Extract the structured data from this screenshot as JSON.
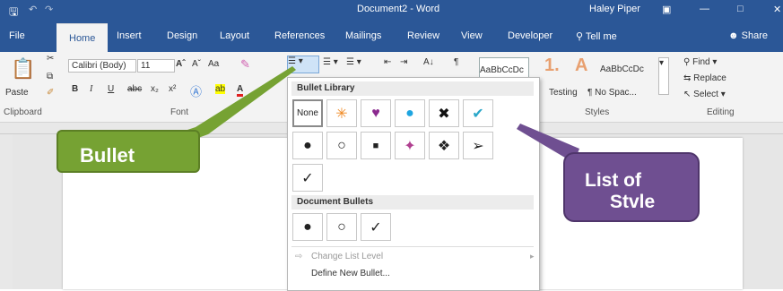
{
  "title_bar": {
    "save_icon": "save-icon",
    "undo_icon": "undo-icon",
    "redo_icon": "redo-icon",
    "document_title": "Document2 - Word",
    "user_name": "Haley Piper",
    "window_controls": [
      "ribbon-display-icon",
      "minimize-icon",
      "maximize-icon",
      "close-icon"
    ]
  },
  "tabs": [
    "File",
    "Home",
    "Insert",
    "Design",
    "Layout",
    "References",
    "Mailings",
    "Review",
    "View",
    "Developer"
  ],
  "active_tab": "Home",
  "tell_me": "Tell me",
  "share": "Share",
  "ribbon": {
    "paste_label": "Paste",
    "font_name": "Calibri (Body)",
    "font_size": "11",
    "case_button": "Aa",
    "bold": "B",
    "italic": "I",
    "underline": "U",
    "strike": "abc",
    "subscript": "x₂",
    "superscript": "x²",
    "highlight": "ab",
    "font_color": "A",
    "sort": "A↓",
    "pilcrow": "¶",
    "styles": [
      "AaBbCcDc",
      "1.",
      "A",
      "AaBbCcDc"
    ],
    "style_names": [
      "Testing",
      "¶ No Spac..."
    ],
    "find": "Find",
    "replace": "Replace",
    "select": "Select",
    "group_labels": {
      "clipboard": "Clipboard",
      "font": "Font",
      "styles": "Styles",
      "editing": "Editing"
    }
  },
  "bullet_dropdown": {
    "library_header": "Bullet Library",
    "none_label": "None",
    "library_row1": [
      "✳",
      "♥",
      "●",
      "✖",
      "✔"
    ],
    "library_row1_colors": [
      "#f08a24",
      "#8b2a8f",
      "#1ea5e0",
      "#111111",
      "#2aa7c9"
    ],
    "library_row2": [
      "●",
      "○",
      "■",
      "✦",
      "❖",
      "➢"
    ],
    "library_row3": [
      "✓"
    ],
    "document_header": "Document Bullets",
    "document_bullets": [
      "●",
      "○",
      "✓"
    ],
    "menu": {
      "change_level": "Change List Level",
      "define_new": "Define New Bullet..."
    }
  },
  "callouts": {
    "bullet": "Bullet",
    "list_of_style_line1": "List of",
    "list_of_style_line2": "Stvle"
  },
  "colors": {
    "ribbon_blue": "#2b5797",
    "callout_green": "#76a233",
    "callout_purple": "#6f4f91"
  }
}
